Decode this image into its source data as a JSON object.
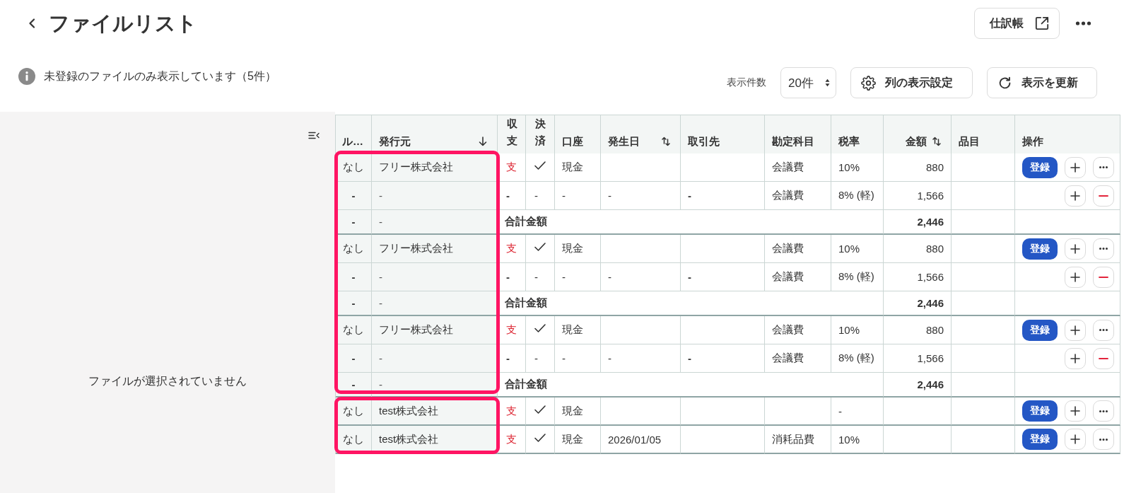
{
  "header": {
    "title": "ファイルリスト",
    "journal_button": "仕訳帳"
  },
  "notice": "未登録のファイルのみ表示しています（5件）",
  "controls": {
    "page_size_label": "表示件数",
    "page_size": "20件",
    "column_settings_button": "列の表示設定",
    "refresh_button": "表示を更新"
  },
  "file_pane": {
    "empty_message": "ファイルが選択されていません"
  },
  "table": {
    "columns": [
      {
        "label": "ル…",
        "sortable": false,
        "sorted": false
      },
      {
        "label": "発行元",
        "sortable": true,
        "sorted": true
      },
      {
        "label": "収支",
        "sortable": false,
        "sorted": false
      },
      {
        "label": "決済",
        "sortable": false,
        "sorted": false
      },
      {
        "label": "口座",
        "sortable": false,
        "sorted": false
      },
      {
        "label": "発生日",
        "sortable": true,
        "sorted": false
      },
      {
        "label": "取引先",
        "sortable": false,
        "sorted": false
      },
      {
        "label": "勘定科目",
        "sortable": false,
        "sorted": false
      },
      {
        "label": "税率",
        "sortable": false,
        "sorted": false
      },
      {
        "label": "金額",
        "sortable": true,
        "sorted": false
      },
      {
        "label": "品目",
        "sortable": false,
        "sorted": false
      },
      {
        "label": "操作",
        "sortable": false,
        "sorted": false
      }
    ],
    "sections": [
      {
        "highlighted": true,
        "groups": [
          {
            "rows": [
              {
                "kind": "entry",
                "rule": "なし",
                "issuer": "フリー株式会社",
                "flow": "支",
                "settled": true,
                "account": "現金",
                "account_title": "会議費",
                "tax_rate": "10%",
                "amount": "880",
                "actions": [
                  {
                    "kind": "register",
                    "label": "登録"
                  },
                  {
                    "kind": "add"
                  },
                  {
                    "kind": "more"
                  }
                ]
              },
              {
                "kind": "split",
                "rule": "-",
                "issuer": "-",
                "flow": "-",
                "settled_text": "-",
                "account": "-",
                "date": "-",
                "partner": "-",
                "account_title": "会議費",
                "tax_rate": "8% (軽)",
                "amount": "1,566",
                "actions": [
                  {
                    "kind": "add"
                  },
                  {
                    "kind": "remove"
                  }
                ]
              },
              {
                "kind": "total",
                "rule": "-",
                "issuer": "-",
                "label": "合計金額",
                "amount": "2,446"
              }
            ]
          },
          {
            "rows": [
              {
                "kind": "entry",
                "rule": "なし",
                "issuer": "フリー株式会社",
                "flow": "支",
                "settled": true,
                "account": "現金",
                "account_title": "会議費",
                "tax_rate": "10%",
                "amount": "880",
                "actions": [
                  {
                    "kind": "register",
                    "label": "登録"
                  },
                  {
                    "kind": "add"
                  },
                  {
                    "kind": "more"
                  }
                ]
              },
              {
                "kind": "split",
                "rule": "-",
                "issuer": "-",
                "flow": "-",
                "settled_text": "-",
                "account": "-",
                "date": "-",
                "partner": "-",
                "account_title": "会議費",
                "tax_rate": "8% (軽)",
                "amount": "1,566",
                "actions": [
                  {
                    "kind": "add"
                  },
                  {
                    "kind": "remove"
                  }
                ]
              },
              {
                "kind": "total",
                "rule": "-",
                "issuer": "-",
                "label": "合計金額",
                "amount": "2,446"
              }
            ]
          },
          {
            "rows": [
              {
                "kind": "entry",
                "rule": "なし",
                "issuer": "フリー株式会社",
                "flow": "支",
                "settled": true,
                "account": "現金",
                "account_title": "会議費",
                "tax_rate": "10%",
                "amount": "880",
                "actions": [
                  {
                    "kind": "register",
                    "label": "登録"
                  },
                  {
                    "kind": "add"
                  },
                  {
                    "kind": "more"
                  }
                ]
              },
              {
                "kind": "split",
                "rule": "-",
                "issuer": "-",
                "flow": "-",
                "settled_text": "-",
                "account": "-",
                "date": "-",
                "partner": "-",
                "account_title": "会議費",
                "tax_rate": "8% (軽)",
                "amount": "1,566",
                "actions": [
                  {
                    "kind": "add"
                  },
                  {
                    "kind": "remove"
                  }
                ]
              },
              {
                "kind": "total",
                "rule": "-",
                "issuer": "-",
                "label": "合計金額",
                "amount": "2,446"
              }
            ]
          }
        ]
      },
      {
        "highlighted": true,
        "groups": [
          {
            "rows": [
              {
                "kind": "entry",
                "rule": "なし",
                "issuer": "test株式会社",
                "flow": "支",
                "settled": true,
                "account": "現金",
                "tax_rate": "-",
                "actions": [
                  {
                    "kind": "register",
                    "label": "登録"
                  },
                  {
                    "kind": "add"
                  },
                  {
                    "kind": "more"
                  }
                ]
              }
            ]
          },
          {
            "rows": [
              {
                "kind": "entry",
                "rule": "なし",
                "issuer": "test株式会社",
                "flow": "支",
                "settled": true,
                "account": "現金",
                "date": "2026/01/05",
                "account_title": "消耗品費",
                "tax_rate": "10%",
                "actions": [
                  {
                    "kind": "register",
                    "label": "登録"
                  },
                  {
                    "kind": "add"
                  },
                  {
                    "kind": "more"
                  }
                ]
              }
            ]
          }
        ]
      }
    ]
  }
}
